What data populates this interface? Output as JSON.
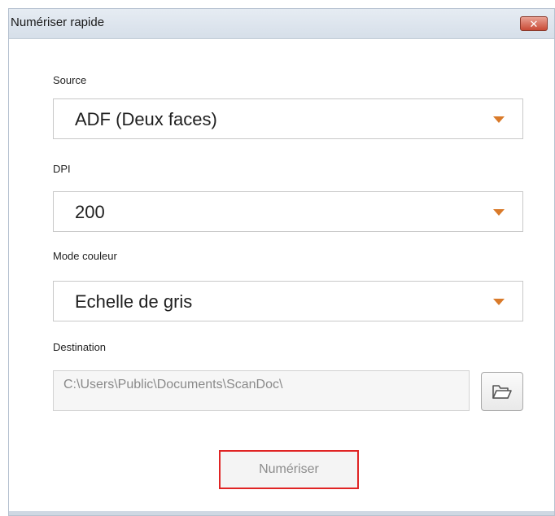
{
  "window": {
    "title": "Numériser rapide",
    "close_symbol": "✕"
  },
  "source": {
    "label": "Source",
    "value": "ADF (Deux faces)"
  },
  "dpi": {
    "label": "DPI",
    "value": "200"
  },
  "color_mode": {
    "label": "Mode couleur",
    "value": "Echelle de gris"
  },
  "destination": {
    "label": "Destination",
    "value": "C:\\Users\\Public\\Documents\\ScanDoc\\",
    "browse_icon": "folder-open-icon"
  },
  "actions": {
    "scan_label": "Numériser"
  },
  "colors": {
    "accent_arrow": "#d97a2a",
    "highlight_border": "#e02424",
    "close_button": "#c94b36"
  }
}
